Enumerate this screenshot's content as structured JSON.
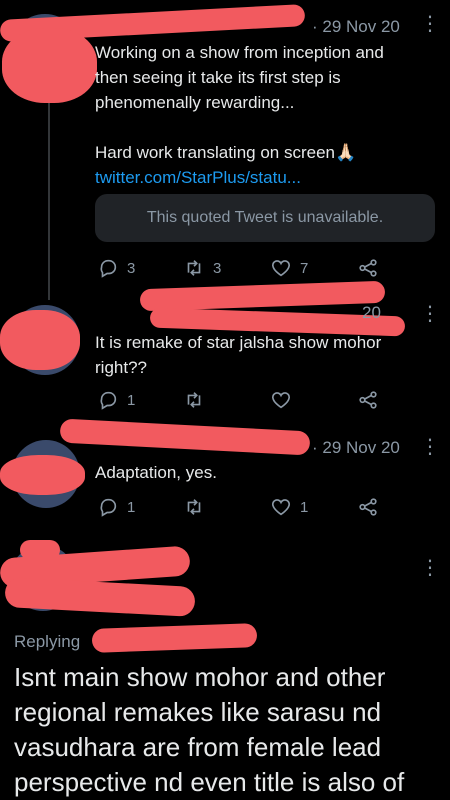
{
  "tweets": [
    {
      "date": "· 29 Nov 20",
      "text_lines": [
        "Working on a show from inception and",
        "then seeing it take its first step is",
        "phenomenally rewarding...",
        "",
        "Hard work translating on screen🙏🏻"
      ],
      "link": "twitter.com/StarPlus/statu...",
      "quote_unavailable": "This quoted Tweet is unavailable.",
      "replies": "3",
      "retweets": "3",
      "likes": "7"
    },
    {
      "date": "20",
      "text_lines": [
        "It is remake of star jalsha show mohor",
        "right??"
      ],
      "replies": "1",
      "retweets": "",
      "likes": ""
    },
    {
      "date": "· 29 Nov 20",
      "text_lines": [
        "Adaptation, yes."
      ],
      "replies": "1",
      "retweets": "",
      "likes": "1"
    }
  ],
  "main_reply": {
    "replying_to": "Replying",
    "text_lines": [
      "Isnt main show mohor and other",
      "regional remakes like sarasu nd",
      "vasudhara are from female lead",
      "perspective nd even title is also of"
    ]
  },
  "icons": [
    "more-icon",
    "reply-icon",
    "retweet-icon",
    "like-icon",
    "share-icon"
  ],
  "colors": {
    "redaction": "#f25a5f",
    "link": "#1d9bf0",
    "muted": "#8b98a5",
    "quote_bg": "#202327"
  }
}
